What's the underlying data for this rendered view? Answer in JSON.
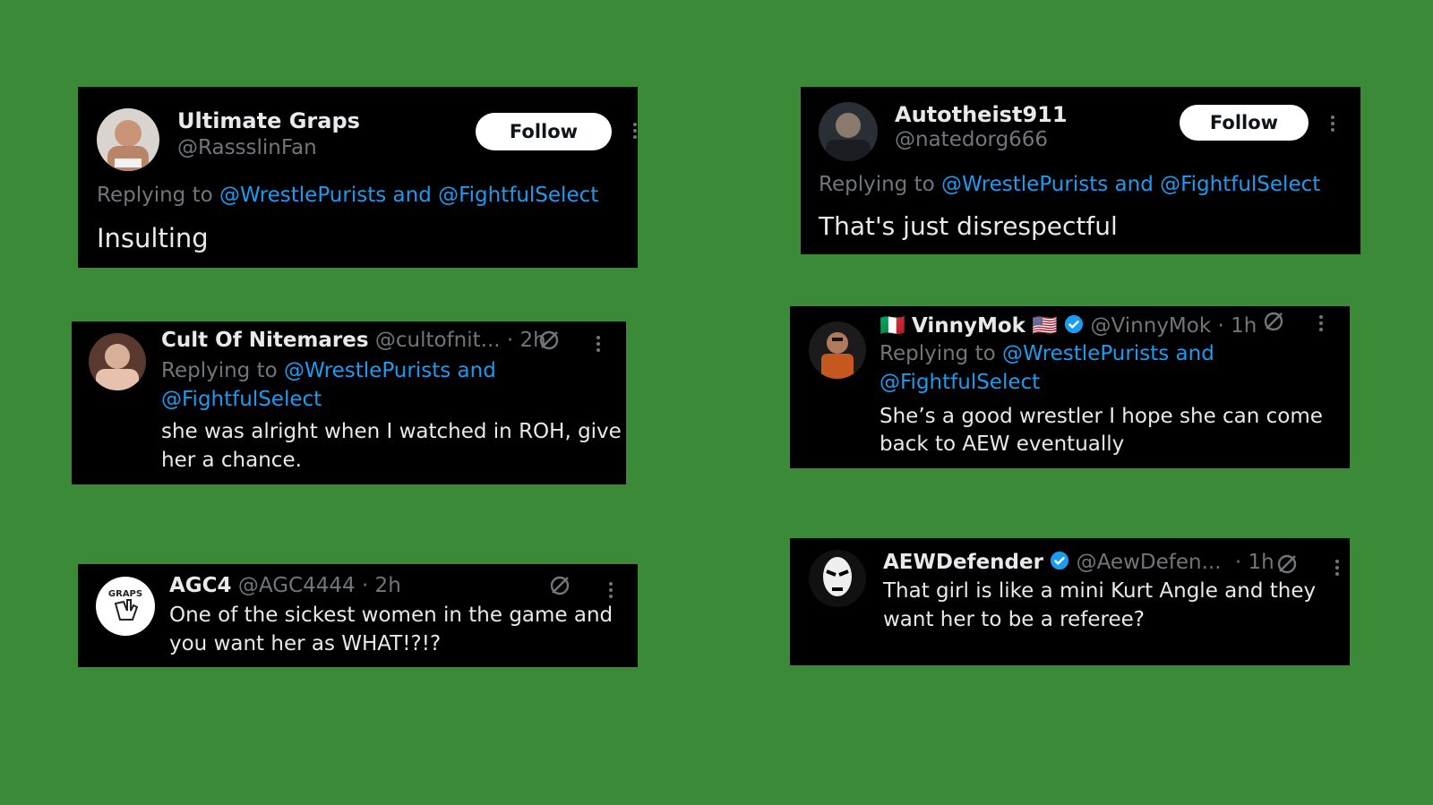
{
  "tweets": [
    {
      "name": "Ultimate Graps",
      "handle": "@RassslinFan",
      "follow_label": "Follow",
      "replying_prefix": "Replying to",
      "replying_to": "@WrestlePurists and @FightfulSelect",
      "text": "Insulting"
    },
    {
      "name": "Autotheist911",
      "handle": "@natedorg666",
      "follow_label": "Follow",
      "replying_prefix": "Replying to",
      "replying_to": "@WrestlePurists and @FightfulSelect",
      "text": "That's just disrespectful"
    },
    {
      "name": "Cult Of Nitemares",
      "handle": "@cultofnit...",
      "time": "· 2h",
      "replying_prefix": "Replying to",
      "replying_to_line1": "@WrestlePurists and",
      "replying_to_line2": "@FightfulSelect",
      "text_line1": "she was alright when I watched in ROH, give",
      "text_line2": "her a chance."
    },
    {
      "flag_left": "🇮🇹",
      "name": "VinnyMok",
      "flag_right": "🇺🇸",
      "handle": "@VinnyMok",
      "time": "· 1h",
      "replying_prefix": "Replying to",
      "replying_to_line1": "@WrestlePurists and",
      "replying_to_line2": "@FightfulSelect",
      "text_line1": "She’s a good wrestler I hope she can come",
      "text_line2": "back to AEW eventually"
    },
    {
      "name": "AGC4",
      "handle": "@AGC4444",
      "time": "· 2h",
      "avatar_text": "GRAPS",
      "text_line1": "One of the sickest women in the game and",
      "text_line2": "you want her as WHAT!?!?"
    },
    {
      "name": "AEWDefender",
      "handle": "@AewDefen...",
      "time": "· 1h",
      "text_line1": "That girl is like a mini Kurt Angle and they",
      "text_line2": "want her to be a referee?"
    }
  ],
  "colors": {
    "background": "#3a8a38",
    "card": "#000000",
    "link": "#1d9bf0",
    "muted": "#71767b",
    "verified": "#1d9bf0"
  },
  "icons": [
    "more-icon",
    "grok-icon",
    "verified-badge-icon"
  ]
}
